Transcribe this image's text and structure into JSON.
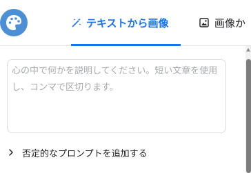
{
  "header": {
    "logo_icon": "palette-icon",
    "tabs": [
      {
        "label": "テキストから画像",
        "icon": "magic-wand-icon",
        "active": true
      },
      {
        "label": "画像か",
        "icon": "image-icon",
        "active": false
      }
    ]
  },
  "prompt": {
    "placeholder": "心の中で何かを説明してください。短い文章を使用し、コンマで区切ります。"
  },
  "negative_prompt": {
    "label": "否定的なプロンプトを追加する",
    "icon": "chevron-right-icon"
  },
  "colors": {
    "accent": "#1a73e8",
    "logo_bg": "#4c8fd4",
    "text": "#202124",
    "placeholder": "#a5a9ae"
  }
}
